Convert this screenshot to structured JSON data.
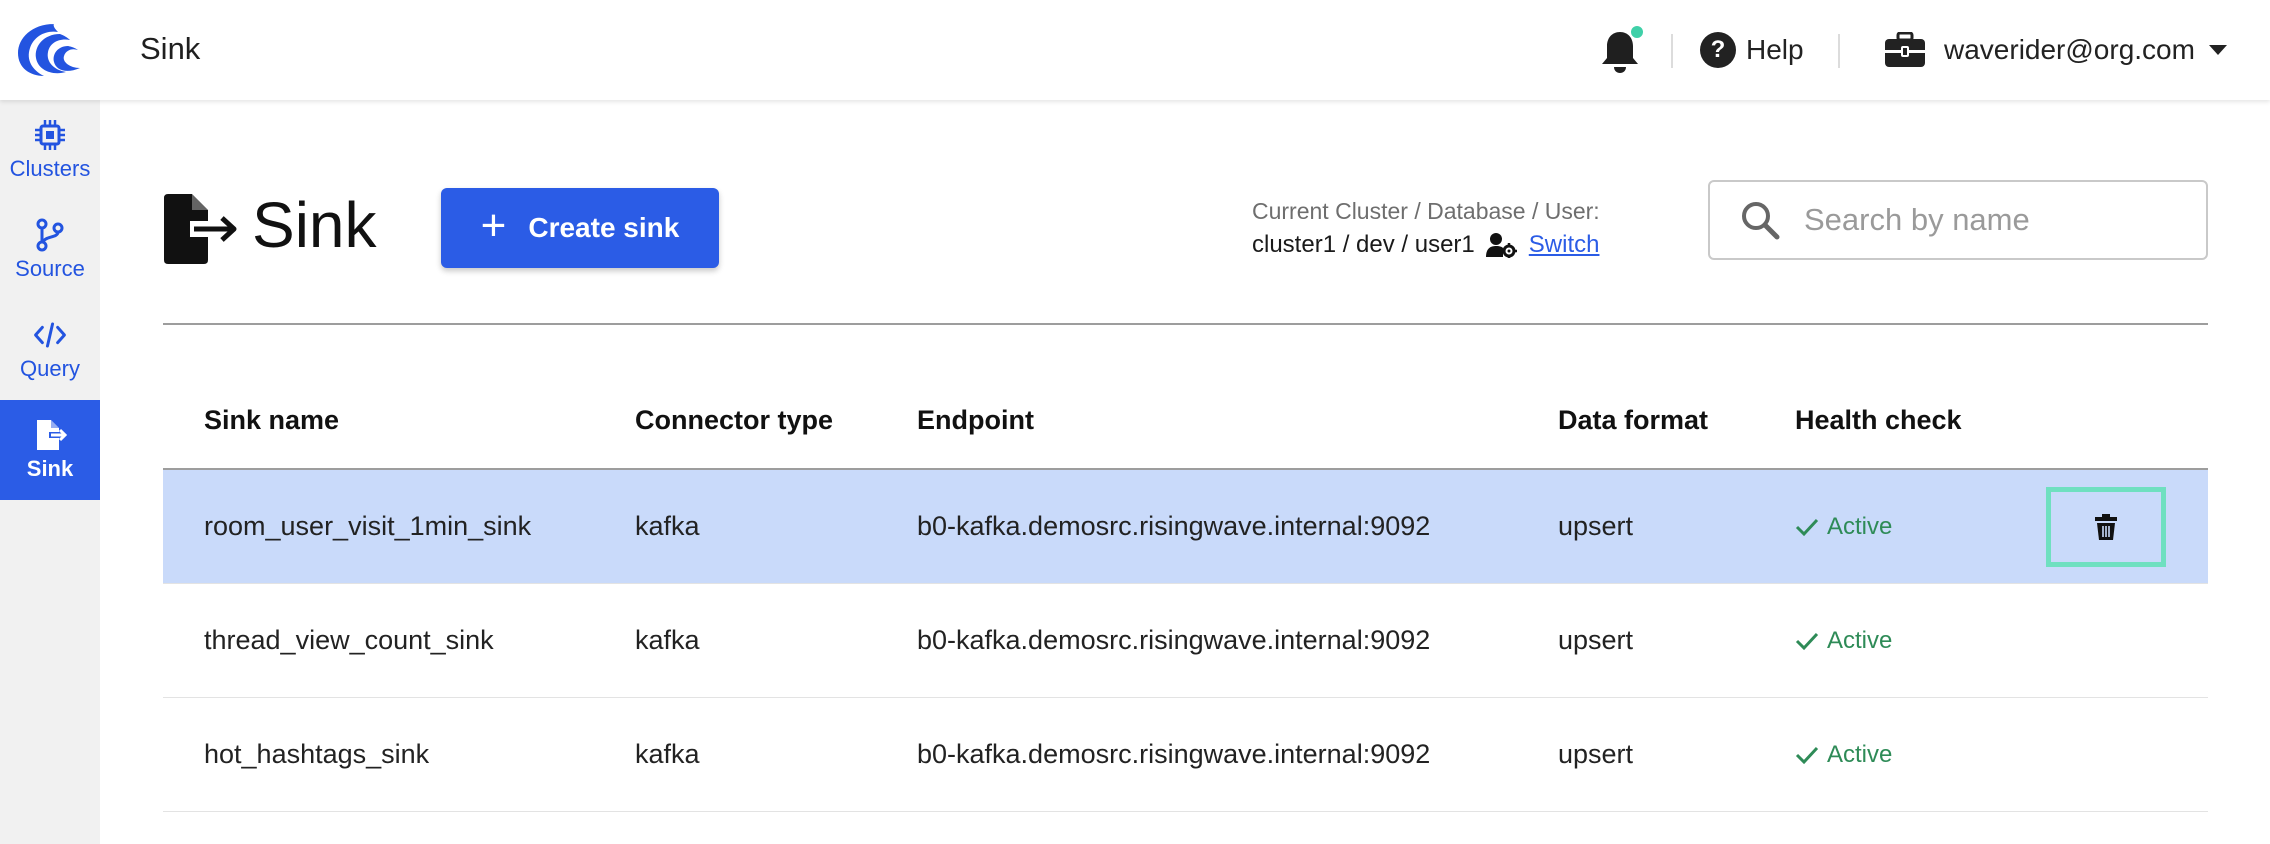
{
  "topbar": {
    "title": "Sink",
    "help_label": "Help",
    "user_email": "waverider@org.com",
    "notification_dot_color": "#3fd0a8"
  },
  "sidebar": {
    "items": [
      {
        "label": "Clusters",
        "icon": "chip-icon",
        "active": false
      },
      {
        "label": "Source",
        "icon": "branch-icon",
        "active": false
      },
      {
        "label": "Query",
        "icon": "code-icon",
        "active": false
      },
      {
        "label": "Sink",
        "icon": "file-export-icon",
        "active": true
      }
    ]
  },
  "header": {
    "title": "Sink",
    "create_button_label": "Create sink",
    "cluster_caption": "Current Cluster / Database / User:",
    "cluster_value": "cluster1 / dev / user1",
    "switch_label": "Switch",
    "search_placeholder": "Search by name",
    "search_value": ""
  },
  "table": {
    "columns": [
      "Sink name",
      "Connector type",
      "Endpoint",
      "Data format",
      "Health check"
    ],
    "rows": [
      {
        "name": "room_user_visit_1min_sink",
        "connector": "kafka",
        "endpoint": "b0-kafka.demosrc.risingwave.internal:9092",
        "format": "upsert",
        "health": "Active",
        "selected": true
      },
      {
        "name": "thread_view_count_sink",
        "connector": "kafka",
        "endpoint": "b0-kafka.demosrc.risingwave.internal:9092",
        "format": "upsert",
        "health": "Active",
        "selected": false
      },
      {
        "name": "hot_hashtags_sink",
        "connector": "kafka",
        "endpoint": "b0-kafka.demosrc.risingwave.internal:9092",
        "format": "upsert",
        "health": "Active",
        "selected": false
      }
    ]
  },
  "colors": {
    "primary": "#2b5ce6",
    "selected_row": "#c9dafa",
    "active_green": "#2e8b57",
    "delete_highlight": "#6fe0c0"
  }
}
